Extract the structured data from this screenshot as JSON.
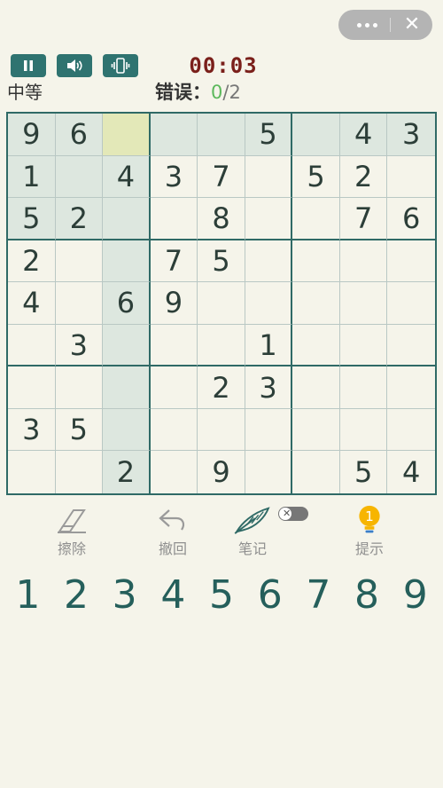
{
  "capsule": {
    "more_icon": "more-dots-icon",
    "close_icon": "close-icon"
  },
  "controls": {
    "pause_icon": "pause-icon",
    "sound_icon": "speaker-icon",
    "vibrate_icon": "vibrate-icon"
  },
  "timer": "00:03",
  "difficulty": "中等",
  "errors": {
    "label": "错误：",
    "current": "0",
    "separator": "/",
    "max": "2"
  },
  "board": {
    "selected": [
      0,
      2
    ],
    "rows": [
      [
        "9",
        "6",
        "",
        "",
        "",
        "5",
        "",
        "4",
        "3"
      ],
      [
        "1",
        "",
        "4",
        "3",
        "7",
        "",
        "5",
        "2",
        ""
      ],
      [
        "5",
        "2",
        "",
        "",
        "8",
        "",
        "",
        "7",
        "6"
      ],
      [
        "2",
        "",
        "",
        "7",
        "5",
        "",
        "",
        "",
        ""
      ],
      [
        "4",
        "",
        "6",
        "9",
        "",
        "",
        "",
        "",
        ""
      ],
      [
        "",
        "3",
        "",
        "",
        "",
        "1",
        "",
        "",
        ""
      ],
      [
        "",
        "",
        "",
        "",
        "2",
        "3",
        "",
        "",
        ""
      ],
      [
        "3",
        "5",
        "",
        "",
        "",
        "",
        "",
        "",
        ""
      ],
      [
        "",
        "",
        "2",
        "",
        "9",
        "",
        "",
        "5",
        "4"
      ]
    ]
  },
  "tools": {
    "erase": {
      "label": "擦除",
      "icon": "eraser-icon"
    },
    "undo": {
      "label": "撤回",
      "icon": "undo-icon"
    },
    "notes": {
      "label": "笔记",
      "icon": "feather-pen-icon",
      "toggle": "off"
    },
    "hint": {
      "label": "提示",
      "icon": "lightbulb-icon",
      "count": "1"
    }
  },
  "numpad": [
    "1",
    "2",
    "3",
    "4",
    "5",
    "6",
    "7",
    "8",
    "9"
  ],
  "colors": {
    "accent": "#2f7370",
    "timer": "#7a1f1a",
    "highlight": "#dde7df",
    "selected": "#e3e8b8",
    "correct": "#5cb85c"
  }
}
